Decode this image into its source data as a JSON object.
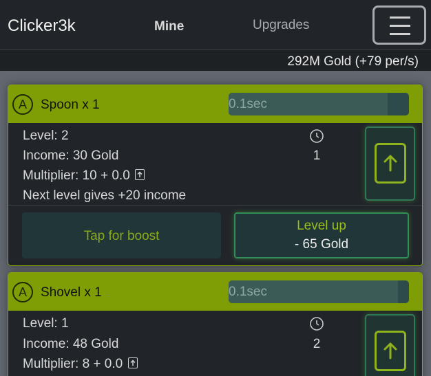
{
  "navbar": {
    "brand": "Clicker3k",
    "tabs": [
      {
        "label": "Mine",
        "active": true
      },
      {
        "label": "Upgrades",
        "active": false
      }
    ],
    "menu_icon": "hamburger-icon"
  },
  "gold_status": "292M Gold (+79 per/s)",
  "colors": {
    "accent": "#7f9e05",
    "background": "#212529",
    "page": "#636870",
    "level_up_border": "#2f8f55"
  },
  "items": [
    {
      "badge": "A",
      "name": "Spoon x 1",
      "progress_text": "0.1sec",
      "progress_fraction": 0.88,
      "level": "Level: 2",
      "income": "Income: 30 Gold",
      "multiplier": "Multiplier: 10 + 0.0",
      "next_level": "Next level gives +20 income",
      "count": "1",
      "boost_label": "Tap for boost",
      "level_up_label": "Level up",
      "level_up_cost": "- 65 Gold"
    },
    {
      "badge": "A",
      "name": "Shovel x 1",
      "progress_text": "0.1sec",
      "progress_fraction": 0.94,
      "level": "Level: 1",
      "income": "Income: 48 Gold",
      "multiplier": "Multiplier: 8 + 0.0",
      "count": "2"
    }
  ]
}
